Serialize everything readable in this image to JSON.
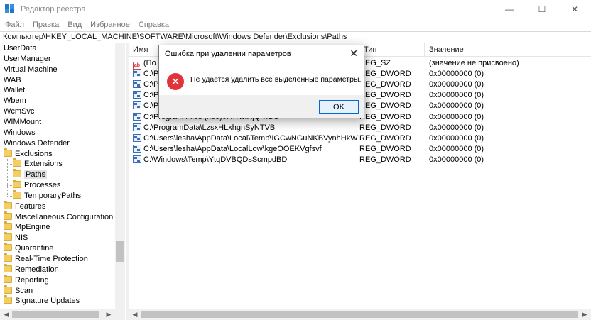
{
  "window": {
    "title": "Редактор реестра",
    "minimize_glyph": "—",
    "maximize_glyph": "☐",
    "close_glyph": "✕"
  },
  "menu": [
    "Файл",
    "Правка",
    "Вид",
    "Избранное",
    "Справка"
  ],
  "address": "Компьютер\\HKEY_LOCAL_MACHINE\\SOFTWARE\\Microsoft\\Windows Defender\\Exclusions\\Paths",
  "tree": {
    "items": [
      {
        "label": "UserData",
        "level": 0,
        "folder": false
      },
      {
        "label": "UserManager",
        "level": 0,
        "folder": false
      },
      {
        "label": "Virtual Machine",
        "level": 0,
        "folder": false
      },
      {
        "label": "WAB",
        "level": 0,
        "folder": false
      },
      {
        "label": "Wallet",
        "level": 0,
        "folder": false
      },
      {
        "label": "Wbem",
        "level": 0,
        "folder": false
      },
      {
        "label": "WcmSvc",
        "level": 0,
        "folder": false
      },
      {
        "label": "WIMMount",
        "level": 0,
        "folder": false
      },
      {
        "label": "Windows",
        "level": 0,
        "folder": false
      },
      {
        "label": "Windows Defender",
        "level": 0,
        "folder": false
      },
      {
        "label": "Exclusions",
        "level": 1,
        "folder": true
      },
      {
        "label": "Extensions",
        "level": 2,
        "folder": true
      },
      {
        "label": "Paths",
        "level": 2,
        "folder": true,
        "selected": true
      },
      {
        "label": "Processes",
        "level": 2,
        "folder": true
      },
      {
        "label": "TemporaryPaths",
        "level": 2,
        "folder": true
      },
      {
        "label": "Features",
        "level": 1,
        "folder": true
      },
      {
        "label": "Miscellaneous Configuration",
        "level": 1,
        "folder": true
      },
      {
        "label": "MpEngine",
        "level": 1,
        "folder": true
      },
      {
        "label": "NIS",
        "level": 1,
        "folder": true
      },
      {
        "label": "Quarantine",
        "level": 1,
        "folder": true
      },
      {
        "label": "Real-Time Protection",
        "level": 1,
        "folder": true
      },
      {
        "label": "Remediation",
        "level": 1,
        "folder": true
      },
      {
        "label": "Reporting",
        "level": 1,
        "folder": true
      },
      {
        "label": "Scan",
        "level": 1,
        "folder": true
      },
      {
        "label": "Signature Updates",
        "level": 1,
        "folder": true
      }
    ]
  },
  "list": {
    "headers": {
      "name": "Имя",
      "type": "Тип",
      "value": "Значение"
    },
    "rows": [
      {
        "icon": "string",
        "name": "(По умолчанию)",
        "type": "REG_SZ",
        "value": "(значение не присвоено)"
      },
      {
        "icon": "dword",
        "name": "C:\\Program Files",
        "type": "REG_DWORD",
        "value": "0x00000000 (0)"
      },
      {
        "icon": "dword",
        "name": "C:\\Program Files (x86)",
        "type": "REG_DWORD",
        "value": "0x00000000 (0)"
      },
      {
        "icon": "dword",
        "name": "C:\\ProgramData",
        "type": "REG_DWORD",
        "value": "0x00000000 (0)"
      },
      {
        "icon": "dword",
        "name": "C:\\Program Files (x86)\\WqTVetvHrOOl",
        "type": "REG_DWORD",
        "value": "0x00000000 (0)"
      },
      {
        "icon": "dword",
        "name": "C:\\Program Files (x86)\\xmTwtRjQlvfBC",
        "type": "REG_DWORD",
        "value": "0x00000000 (0)"
      },
      {
        "icon": "dword",
        "name": "C:\\ProgramData\\LzsxHLxhgnSyNTVB",
        "type": "REG_DWORD",
        "value": "0x00000000 (0)"
      },
      {
        "icon": "dword",
        "name": "C:\\Users\\lesha\\AppData\\Local\\Temp\\IGCwNGuNKBVynhHkW",
        "type": "REG_DWORD",
        "value": "0x00000000 (0)"
      },
      {
        "icon": "dword",
        "name": "C:\\Users\\lesha\\AppData\\LocalLow\\kgeOOEKVgfsvf",
        "type": "REG_DWORD",
        "value": "0x00000000 (0)"
      },
      {
        "icon": "dword",
        "name": "C:\\Windows\\Temp\\YtqDVBQDsScmpdBD",
        "type": "REG_DWORD",
        "value": "0x00000000 (0)"
      }
    ]
  },
  "dialog": {
    "title": "Ошибка при удалении параметров",
    "message": "Не удается удалить все выделенные параметры.",
    "ok_label": "OK",
    "close_glyph": "✕",
    "error_glyph": "✕"
  },
  "colors": {
    "error_red": "#e2323a",
    "ok_border": "#0a64d6",
    "folder_yellow": "#f4ce62"
  }
}
